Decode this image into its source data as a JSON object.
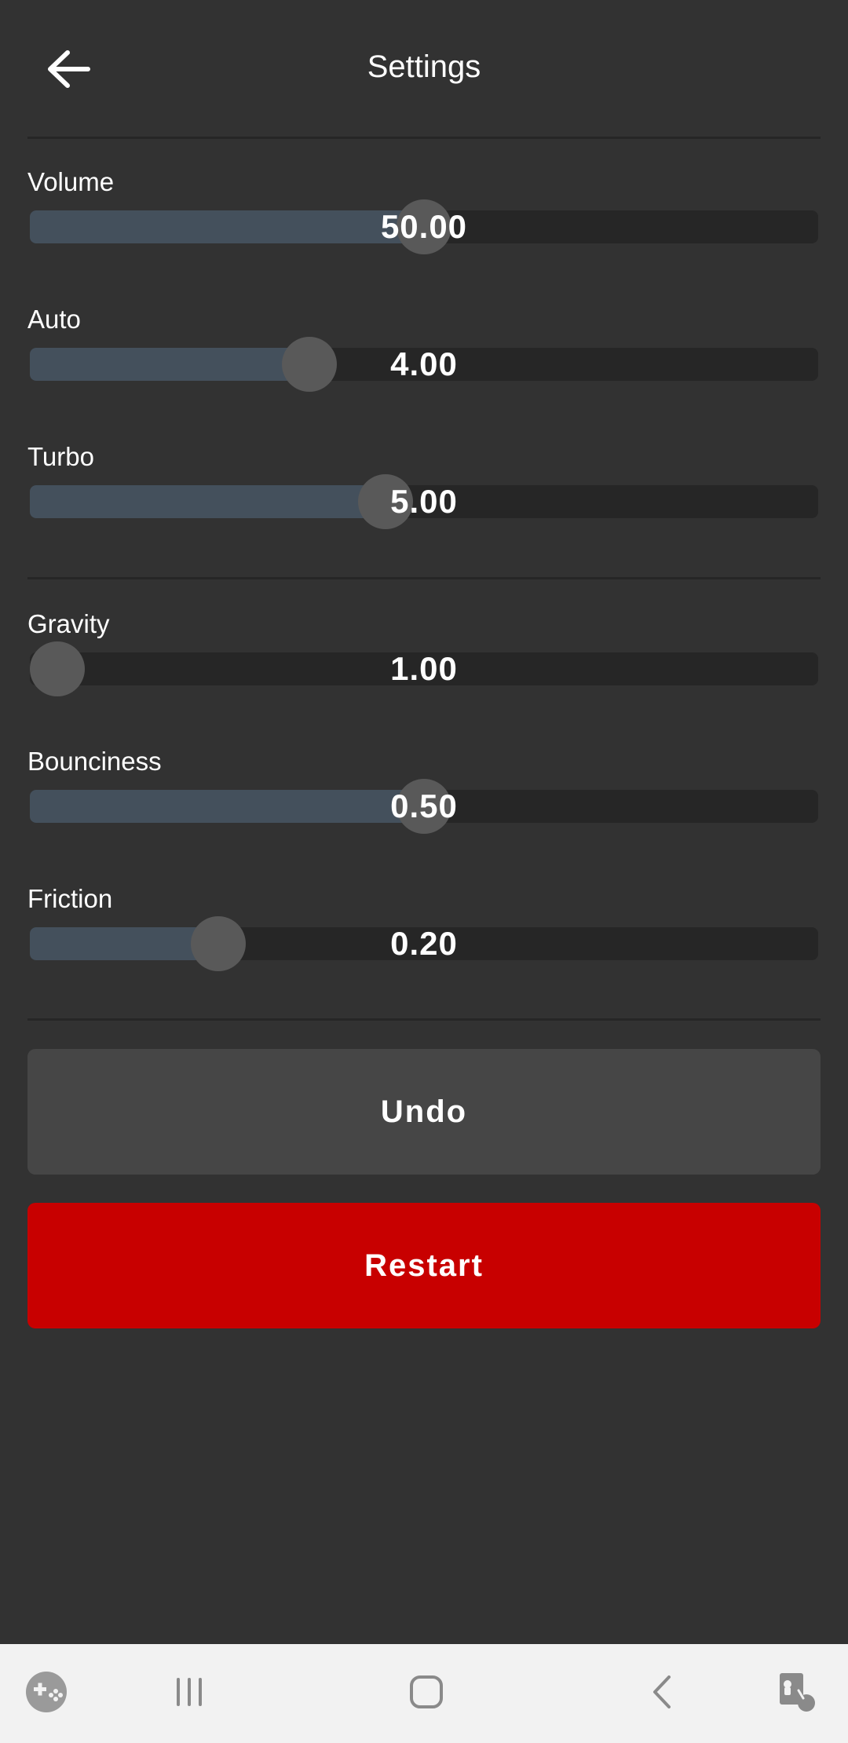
{
  "header": {
    "title": "Settings"
  },
  "icons": {
    "back": "arrow-left-icon",
    "game": "gamepad-icon",
    "recents": "recent-apps-icon",
    "home": "home-icon",
    "nav_back": "chevron-left-icon",
    "accessibility": "accessibility-touch-icon"
  },
  "colors": {
    "background": "#323232",
    "track": "#262626",
    "fill": "#44505c",
    "thumb": "#595959",
    "undo_button": "#464646",
    "restart_button": "#c80000",
    "navbar": "#f2f2f2"
  },
  "sliders": [
    {
      "label": "Volume",
      "value": "50.00",
      "fraction": 0.5
    },
    {
      "label": "Auto",
      "value": "4.00",
      "fraction": 0.344
    },
    {
      "label": "Turbo",
      "value": "5.00",
      "fraction": 0.448
    },
    {
      "label": "Gravity",
      "value": "1.00",
      "fraction": 0.0
    },
    {
      "label": "Bounciness",
      "value": "0.50",
      "fraction": 0.5
    },
    {
      "label": "Friction",
      "value": "0.20",
      "fraction": 0.22
    }
  ],
  "buttons": {
    "undo_label": "Undo",
    "restart_label": "Restart"
  }
}
